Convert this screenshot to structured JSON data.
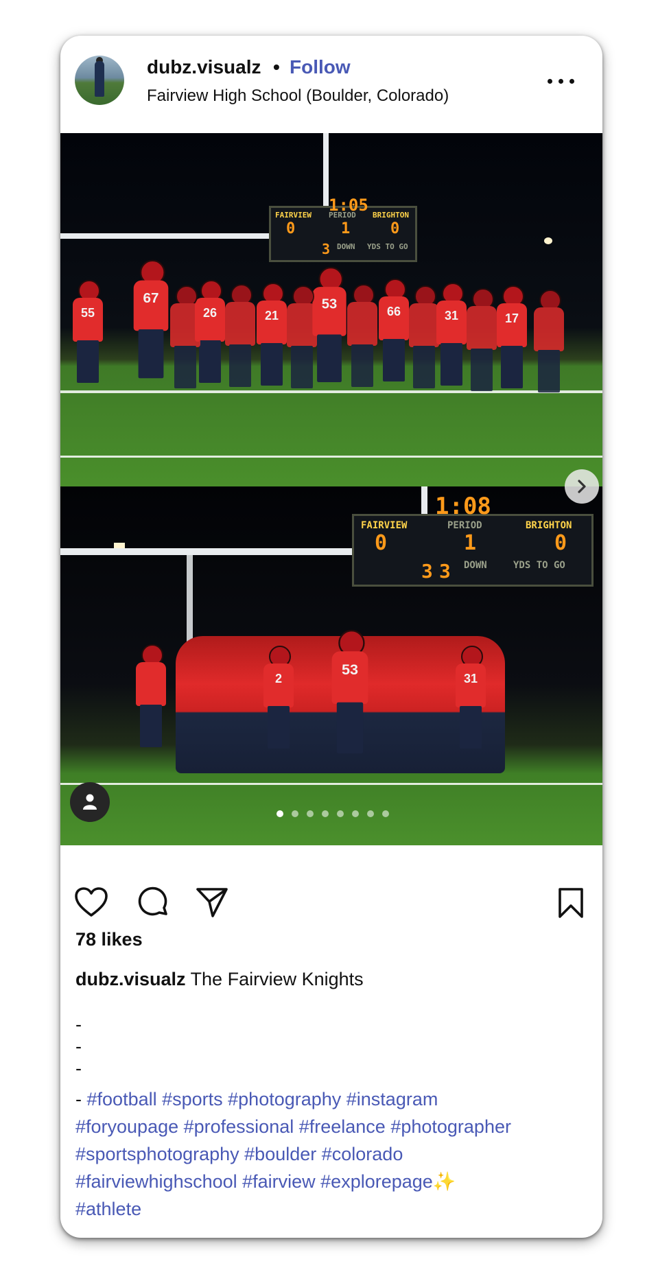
{
  "post": {
    "username": "dubz.visualz",
    "separator": "•",
    "follow_label": "Follow",
    "location": "Fairview High School (Boulder, Colorado)",
    "more_icon": "more-horizontal-icon"
  },
  "photo1": {
    "scoreboard_time": "1:05",
    "home_label": "FAIRVIEW",
    "home_score": "0",
    "period_label": "PERIOD",
    "period": "1",
    "away_label": "BRIGHTON",
    "away_score": "0",
    "down_label": "DOWN",
    "togo_label": "YDS TO GO",
    "down_value": "3",
    "jerseys": [
      "55",
      "67",
      "26",
      "21",
      "53",
      "66",
      "31",
      "17"
    ]
  },
  "photo2": {
    "scoreboard_time": "1:08",
    "home_label": "FAIRVIEW",
    "home_score": "0",
    "period_label": "PERIOD",
    "period": "1",
    "away_label": "BRIGHTON",
    "away_score": "0",
    "down_label": "DOWN",
    "togo_label": "YDS TO GO",
    "down_value": "3",
    "togo_value": "3",
    "jerseys": [
      "2",
      "53",
      "31"
    ]
  },
  "carousel": {
    "slide_count": 8,
    "active_index": 0
  },
  "actions": {
    "like_icon": "heart-icon",
    "comment_icon": "comment-icon",
    "share_icon": "send-icon",
    "save_icon": "bookmark-icon"
  },
  "likes_text": "78 likes",
  "caption": {
    "username": "dubz.visualz",
    "text": " The Fairview Knights",
    "dashes": [
      "-",
      "-",
      "-"
    ],
    "tag_line_prefix": "-",
    "hashtags_line1": "#football #sports #photography #instagram",
    "hashtags_line2": "#foryoupage #professional #freelance #photographer",
    "hashtags_line3": "#sportsphotography #boulder #colorado",
    "hashtags_line4": "#fairviewhighschool #fairview #explorepage",
    "sparkle": "✨",
    "hashtags_line5": "#athlete"
  },
  "colors": {
    "link": "#4959b5",
    "jersey_red": "#e12c2c",
    "field_green": "#4a8f2b"
  }
}
